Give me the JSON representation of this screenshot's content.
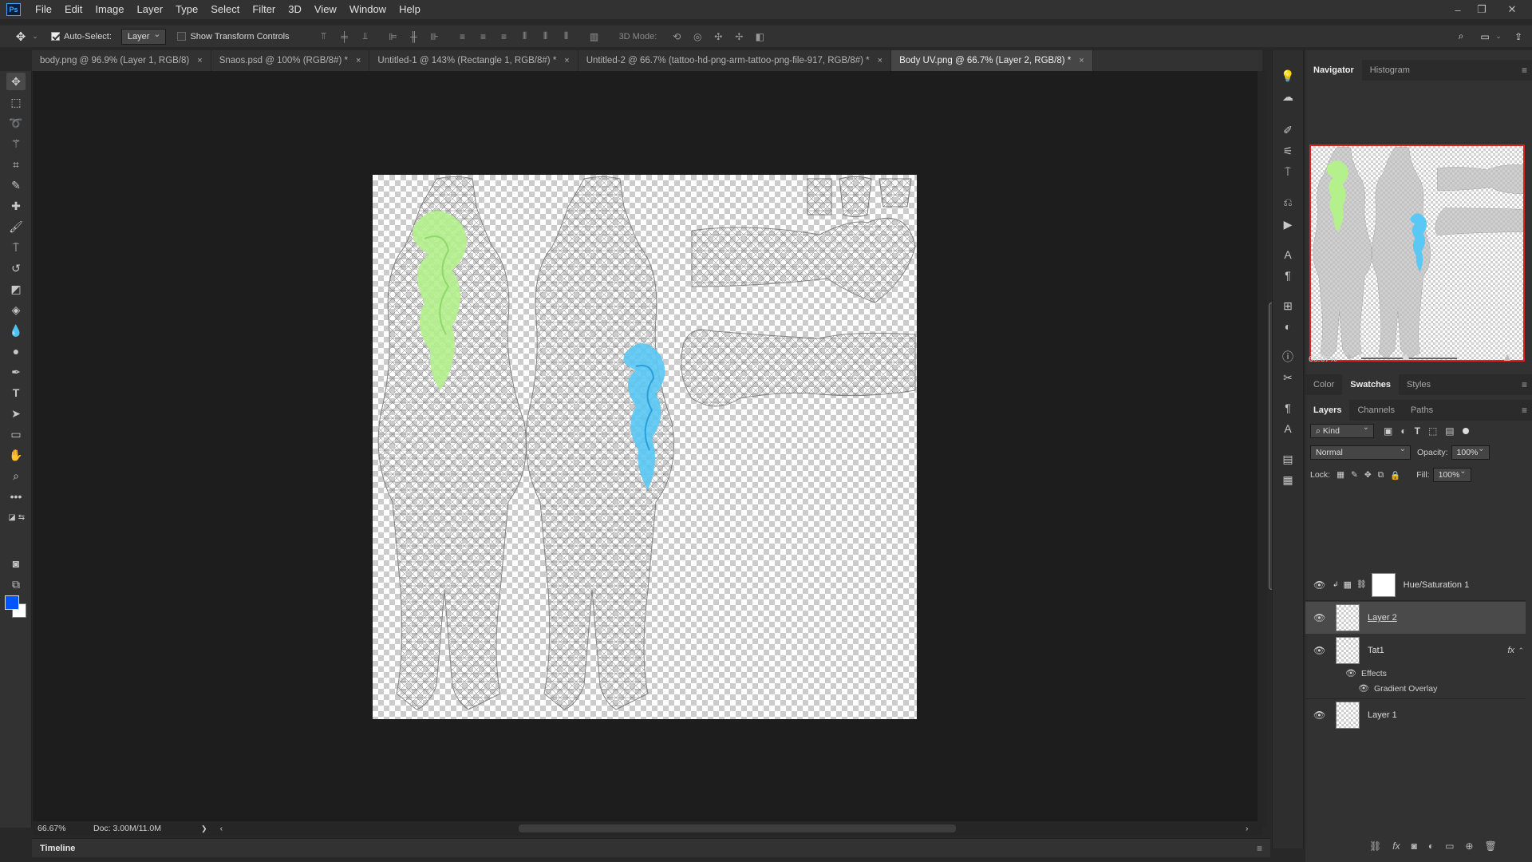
{
  "app": {
    "logo": "Ps",
    "menu": [
      "File",
      "Edit",
      "Image",
      "Layer",
      "Type",
      "Select",
      "Filter",
      "3D",
      "View",
      "Window",
      "Help"
    ],
    "window_controls": {
      "minimize": "–",
      "restore": "❐",
      "close": "✕"
    }
  },
  "options_bar": {
    "auto_select_label": "Auto-Select:",
    "auto_select_checked": true,
    "target_value": "Layer",
    "show_transform_label": "Show Transform Controls",
    "show_transform_checked": false,
    "mode_3d_label": "3D Mode:"
  },
  "tabs": [
    {
      "label": "body.png @ 96.9% (Layer 1, RGB/8)",
      "active": false
    },
    {
      "label": "Snaos.psd @ 100% (RGB/8#) *",
      "active": false
    },
    {
      "label": "Untitled-1 @ 143% (Rectangle 1, RGB/8#) *",
      "active": false
    },
    {
      "label": "Untitled-2 @ 66.7% (tattoo-hd-png-arm-tattoo-png-file-917, RGB/8#) *",
      "active": false
    },
    {
      "label": "Body UV.png @ 66.7% (Layer 2, RGB/8) *",
      "active": true
    }
  ],
  "tab_close": "×",
  "colors": {
    "foreground": "#0055ff",
    "background": "#ffffff",
    "tattoo_green": "#b4f08c",
    "tattoo_blue": "#5ac8f5",
    "nav_frame": "#e02020"
  },
  "status": {
    "zoom": "66.67%",
    "doc": "Doc: 3.00M/11.0M",
    "arrow": "❯",
    "left_arrow": "‹",
    "right_arrow": "›"
  },
  "timeline": {
    "label": "Timeline"
  },
  "navigator": {
    "tabs": [
      "Navigator",
      "Histogram"
    ],
    "active_tab": "Navigator",
    "zoom": "66.67%"
  },
  "color_panel": {
    "tabs": [
      "Color",
      "Swatches",
      "Styles"
    ],
    "active_tab": "Swatches"
  },
  "layers_panel": {
    "tabs": [
      "Layers",
      "Channels",
      "Paths"
    ],
    "active_tab": "Layers",
    "filter_kind": "Kind",
    "blend_mode": "Normal",
    "opacity_label": "Opacity:",
    "opacity_value": "100%",
    "lock_label": "Lock:",
    "fill_label": "Fill:",
    "fill_value": "100%",
    "layers": [
      {
        "name": "Hue/Saturation 1",
        "type": "adjustment"
      },
      {
        "name": "Layer 2",
        "type": "pixel",
        "selected": true
      },
      {
        "name": "Tat1",
        "type": "smart",
        "fx": "fx",
        "effects_label": "Effects",
        "effect": "Gradient Overlay"
      },
      {
        "name": "Layer 1",
        "type": "pixel"
      }
    ]
  }
}
